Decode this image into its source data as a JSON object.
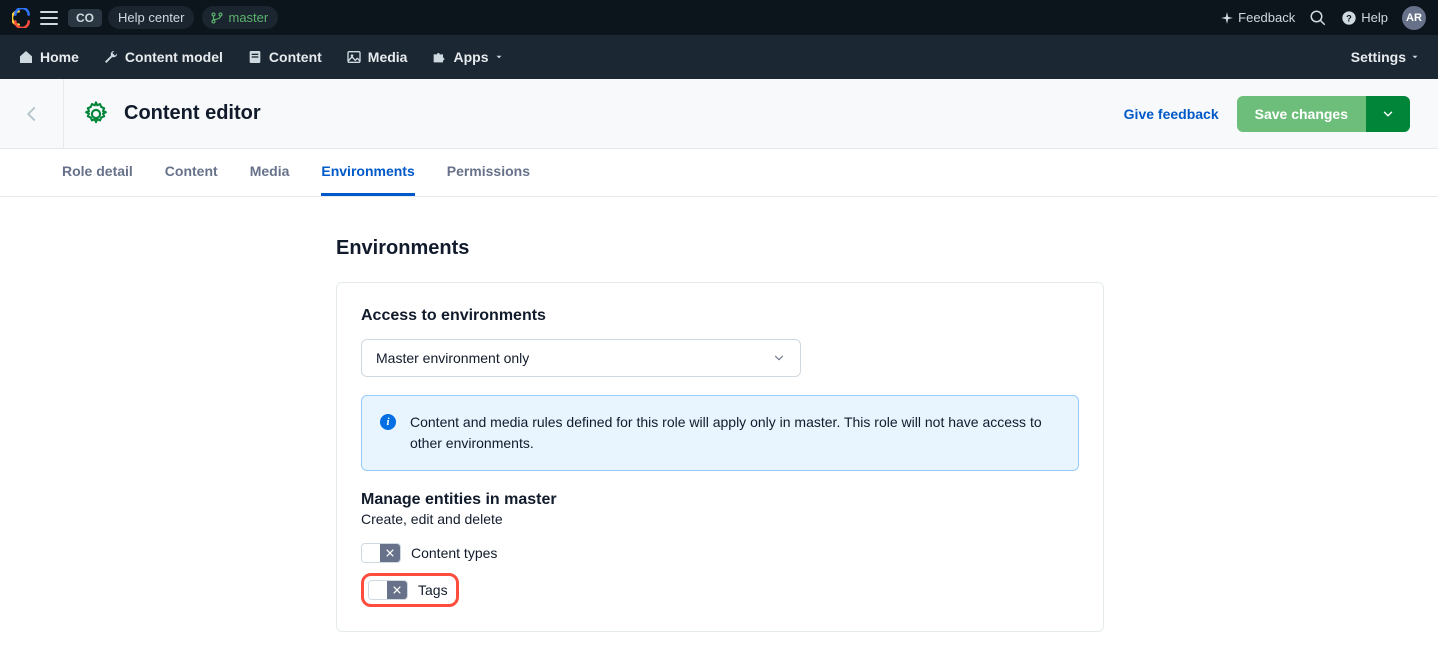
{
  "topbar": {
    "space_badge": "CO",
    "space_name": "Help center",
    "branch": "master",
    "feedback": "Feedback",
    "help": "Help",
    "avatar": "AR"
  },
  "nav": {
    "items": [
      {
        "label": "Home"
      },
      {
        "label": "Content model"
      },
      {
        "label": "Content"
      },
      {
        "label": "Media"
      },
      {
        "label": "Apps"
      }
    ],
    "settings": "Settings"
  },
  "subheader": {
    "title": "Content editor",
    "feedback": "Give feedback",
    "save": "Save changes"
  },
  "tabs": [
    {
      "label": "Role detail",
      "active": false
    },
    {
      "label": "Content",
      "active": false
    },
    {
      "label": "Media",
      "active": false
    },
    {
      "label": "Environments",
      "active": true
    },
    {
      "label": "Permissions",
      "active": false
    }
  ],
  "section": {
    "title": "Environments",
    "access_label": "Access to environments",
    "select_value": "Master environment only",
    "info_text": "Content and media rules defined for this role will apply only in master. This role will not have access to other environments.",
    "manage_label": "Manage entities in master",
    "manage_desc": "Create, edit and delete",
    "toggles": [
      {
        "label": "Content types"
      },
      {
        "label": "Tags"
      }
    ]
  }
}
